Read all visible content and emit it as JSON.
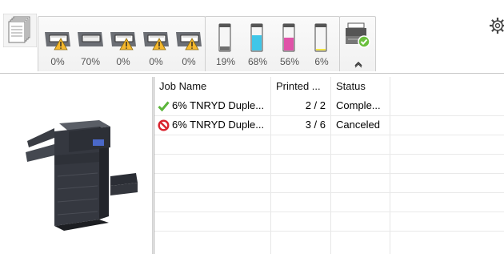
{
  "trays": [
    {
      "name": "tray-1",
      "level": "0%",
      "warning": true
    },
    {
      "name": "tray-2",
      "level": "70%",
      "warning": false
    },
    {
      "name": "tray-3",
      "level": "0%",
      "warning": true
    },
    {
      "name": "tray-4",
      "level": "0%",
      "warning": true
    },
    {
      "name": "tray-5",
      "level": "0%",
      "warning": true
    }
  ],
  "toners": [
    {
      "name": "black",
      "level": "19%",
      "color": "#6f6f6f"
    },
    {
      "name": "cyan",
      "level": "68%",
      "color": "#3fc6e8"
    },
    {
      "name": "magenta",
      "level": "56%",
      "color": "#e052a8"
    },
    {
      "name": "yellow",
      "level": "6%",
      "color": "#f2e545"
    }
  ],
  "jobs": {
    "columns": {
      "name": "Job Name",
      "printed": "Printed ...",
      "status": "Status"
    },
    "rows": [
      {
        "name": "6% TNRYD Duple...",
        "printed": "2 / 2",
        "status": "Comple...",
        "icon": "check-icon"
      },
      {
        "name": "6% TNRYD Duple...",
        "printed": "3 / 6",
        "status": "Canceled",
        "icon": "cancel-icon"
      }
    ]
  },
  "icons": {
    "document_stack": "document-stack-icon",
    "settings": "gear-icon",
    "collapse": "chevron-up-icon",
    "device": "device-status-icon"
  },
  "colors": {
    "check": "#5bb53a",
    "cancel": "#d9232e",
    "warning": "#f5b82e"
  }
}
